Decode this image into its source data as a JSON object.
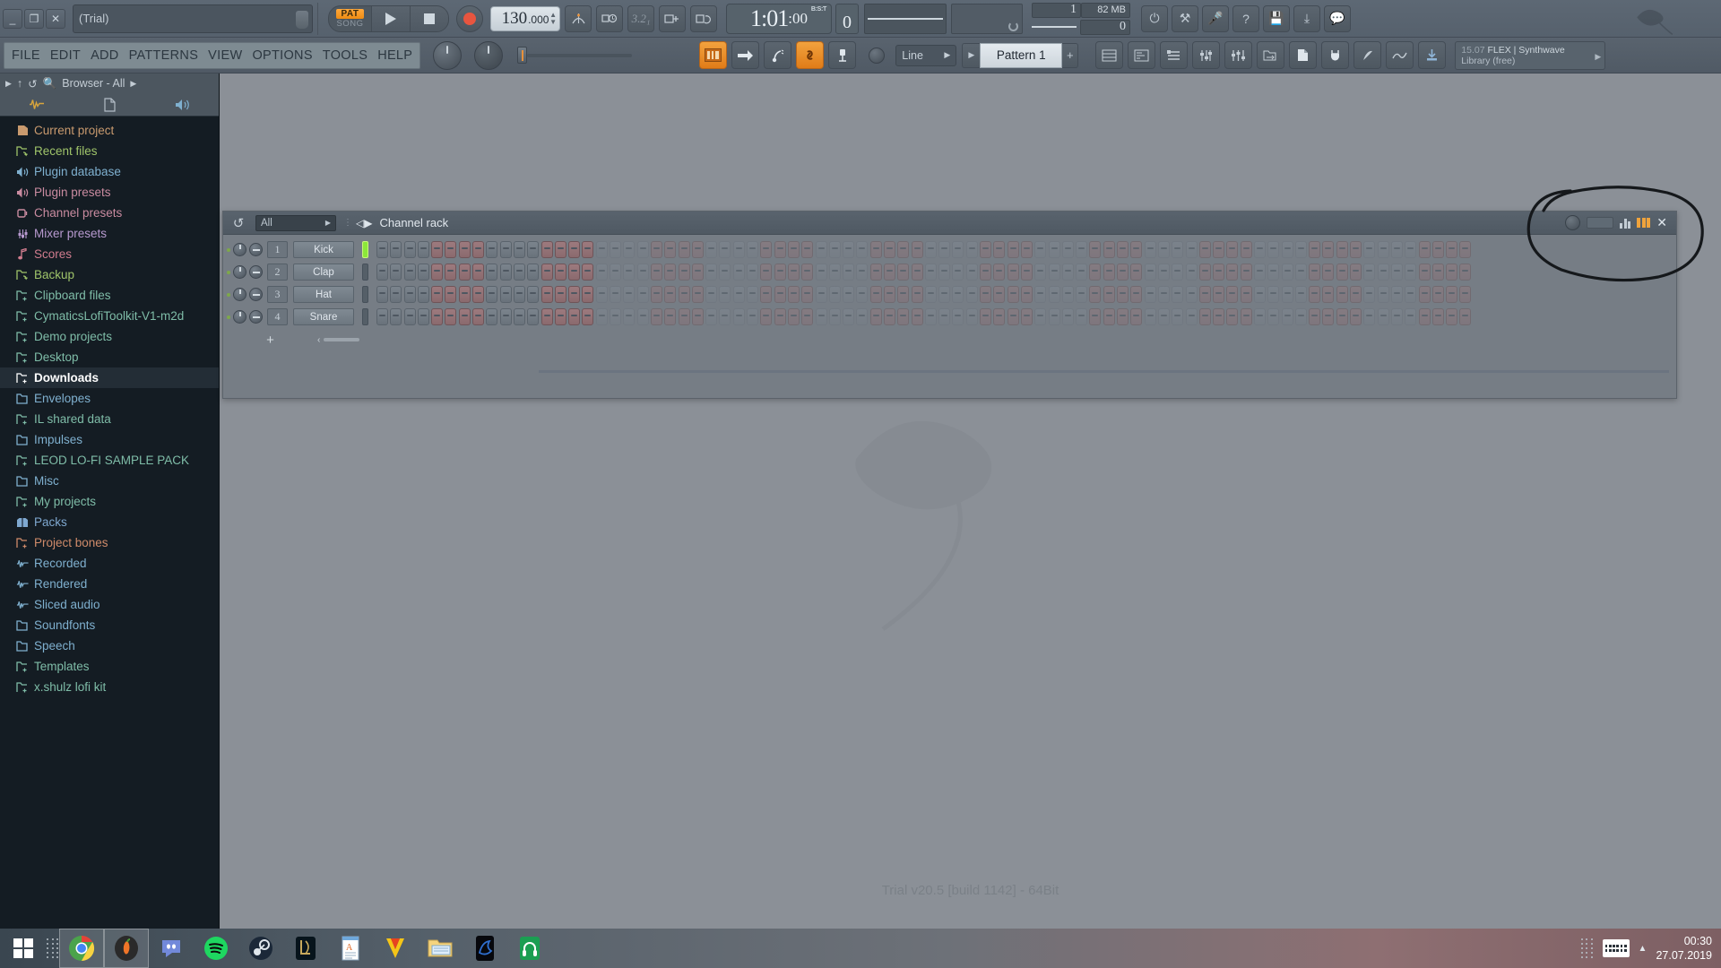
{
  "window": {
    "title": "(Trial)",
    "minimize": "_",
    "restore": "❐",
    "close": "✕"
  },
  "menubar": {
    "items": [
      "FILE",
      "EDIT",
      "ADD",
      "PATTERNS",
      "VIEW",
      "OPTIONS",
      "TOOLS",
      "HELP"
    ]
  },
  "transport": {
    "pat_label": "PAT",
    "song_label": "SONG",
    "play_icon": "play-icon",
    "stop_icon": "stop-icon",
    "record_icon": "record-icon",
    "tempo_int": "130",
    "tempo_frac": ".000",
    "time_main": "1:01",
    "time_sub": ":00",
    "time_unit": "B:S:T",
    "bst_value": "0",
    "memory": "82 MB",
    "cpu_value": "1",
    "voices": "0"
  },
  "toolbar2": {
    "snap_label": "Line",
    "pattern_name": "Pattern 1",
    "pattern_plus": "+",
    "buttons": [
      {
        "name": "playlist-button",
        "glyph": "▦",
        "active": true
      },
      {
        "name": "step-sequencer-button",
        "glyph": "➜",
        "active": false
      },
      {
        "name": "piano-roll-button",
        "glyph": "♪",
        "active": false
      },
      {
        "name": "link-button",
        "glyph": "🔗",
        "active": true
      },
      {
        "name": "mixer-button",
        "glyph": "▯",
        "active": false
      }
    ]
  },
  "plugin_panel": {
    "time": "15.07",
    "name": "FLEX | Synthwave",
    "sub": "Library (free)"
  },
  "browser": {
    "header": "Browser - All",
    "back_icon": "chevron-right-icon",
    "up_icon": "arrow-up-icon",
    "refresh_icon": "undo-icon",
    "search_icon": "search-icon",
    "tabs": [
      "waveform-icon",
      "file-icon",
      "plugin-icon"
    ],
    "items": [
      {
        "label": "Current project",
        "color": "#c99a6e",
        "icon": "project-icon"
      },
      {
        "label": "Recent files",
        "color": "#9fc46a",
        "icon": "folder-link-icon"
      },
      {
        "label": "Plugin database",
        "color": "#7fb0cf",
        "icon": "plugin-icon"
      },
      {
        "label": "Plugin presets",
        "color": "#c98ba0",
        "icon": "plugin-icon"
      },
      {
        "label": "Channel presets",
        "color": "#c98ba0",
        "icon": "channel-icon"
      },
      {
        "label": "Mixer presets",
        "color": "#b89ad0",
        "icon": "mixer-icon"
      },
      {
        "label": "Scores",
        "color": "#d07c8e",
        "icon": "note-icon"
      },
      {
        "label": "Backup",
        "color": "#9fc46a",
        "icon": "folder-link-icon"
      },
      {
        "label": "Clipboard files",
        "color": "#7fbda8",
        "icon": "folder-icon"
      },
      {
        "label": "CymaticsLofiToolkit-V1-m2d",
        "color": "#7fbda8",
        "icon": "folder-icon"
      },
      {
        "label": "Demo projects",
        "color": "#7fbda8",
        "icon": "folder-icon"
      },
      {
        "label": "Desktop",
        "color": "#7fbda8",
        "icon": "folder-icon"
      },
      {
        "label": "Downloads",
        "color": "#ffffff",
        "icon": "folder-icon",
        "selected": true
      },
      {
        "label": "Envelopes",
        "color": "#7fb0cf",
        "icon": "folder-plain-icon"
      },
      {
        "label": "IL shared data",
        "color": "#7fbda8",
        "icon": "folder-icon"
      },
      {
        "label": "Impulses",
        "color": "#7fb0cf",
        "icon": "folder-plain-icon"
      },
      {
        "label": "LEOD LO-FI SAMPLE PACK",
        "color": "#7fbda8",
        "icon": "folder-icon"
      },
      {
        "label": "Misc",
        "color": "#7fb0cf",
        "icon": "folder-plain-icon"
      },
      {
        "label": "My projects",
        "color": "#7fbda8",
        "icon": "folder-icon"
      },
      {
        "label": "Packs",
        "color": "#7fa8d0",
        "icon": "package-icon"
      },
      {
        "label": "Project bones",
        "color": "#d08b6a",
        "icon": "folder-icon"
      },
      {
        "label": "Recorded",
        "color": "#7fb0cf",
        "icon": "waveform-icon"
      },
      {
        "label": "Rendered",
        "color": "#7fb0cf",
        "icon": "waveform-icon"
      },
      {
        "label": "Sliced audio",
        "color": "#7fb0cf",
        "icon": "waveform-icon"
      },
      {
        "label": "Soundfonts",
        "color": "#7fb0cf",
        "icon": "folder-plain-icon"
      },
      {
        "label": "Speech",
        "color": "#7fb0cf",
        "icon": "folder-plain-icon"
      },
      {
        "label": "Templates",
        "color": "#7fbda8",
        "icon": "folder-icon"
      },
      {
        "label": "x.shulz lofi kit",
        "color": "#7fbda8",
        "icon": "folder-icon"
      }
    ]
  },
  "channel_rack": {
    "title": "Channel rack",
    "filter": "All",
    "undo_icon": "undo-icon",
    "close_icon": "close-icon",
    "add_channel": "+",
    "channels": [
      {
        "num": "1",
        "name": "Kick",
        "vu_active": true
      },
      {
        "num": "2",
        "name": "Clap",
        "vu_active": false
      },
      {
        "num": "3",
        "name": "Hat",
        "vu_active": false
      },
      {
        "num": "4",
        "name": "Snare",
        "vu_active": false
      }
    ],
    "step_count": 80,
    "visible_steps": 16,
    "step_patterns": {
      "Kick": [
        0,
        0,
        0,
        0,
        1,
        1,
        1,
        1,
        0,
        0,
        0,
        0,
        1,
        1,
        1,
        1
      ],
      "Clap": [
        0,
        0,
        0,
        0,
        1,
        1,
        1,
        1,
        0,
        0,
        0,
        0,
        1,
        1,
        1,
        1
      ],
      "Hat": [
        0,
        0,
        0,
        0,
        1,
        1,
        1,
        1,
        0,
        0,
        0,
        0,
        1,
        1,
        1,
        1
      ],
      "Snare": [
        0,
        0,
        0,
        0,
        1,
        1,
        1,
        1,
        0,
        0,
        0,
        0,
        1,
        1,
        1,
        1
      ]
    }
  },
  "workspace": {
    "version_text": "Trial v20.5 [build 1142] - 64Bit"
  },
  "taskbar": {
    "start_icon": "windows-start-icon",
    "apps": [
      {
        "name": "chrome-icon",
        "active": true
      },
      {
        "name": "fl-studio-icon",
        "active": true
      },
      {
        "name": "discord-icon",
        "active": false
      },
      {
        "name": "spotify-icon",
        "active": false
      },
      {
        "name": "steam-icon",
        "active": false
      },
      {
        "name": "league-of-legends-icon",
        "active": false
      },
      {
        "name": "wordpad-icon",
        "active": false
      },
      {
        "name": "vegas-pro-icon",
        "active": false
      },
      {
        "name": "file-explorer-icon",
        "active": false
      },
      {
        "name": "blender-icon",
        "active": false
      },
      {
        "name": "audio-app-icon",
        "active": false
      }
    ],
    "tray": {
      "keyboard_icon": "keyboard-icon",
      "expand_icon": "chevron-up-icon",
      "time": "00:30",
      "date": "27.07.2019"
    }
  },
  "annotation": {
    "shape": "hand-drawn-circle",
    "color": "#15181b"
  }
}
